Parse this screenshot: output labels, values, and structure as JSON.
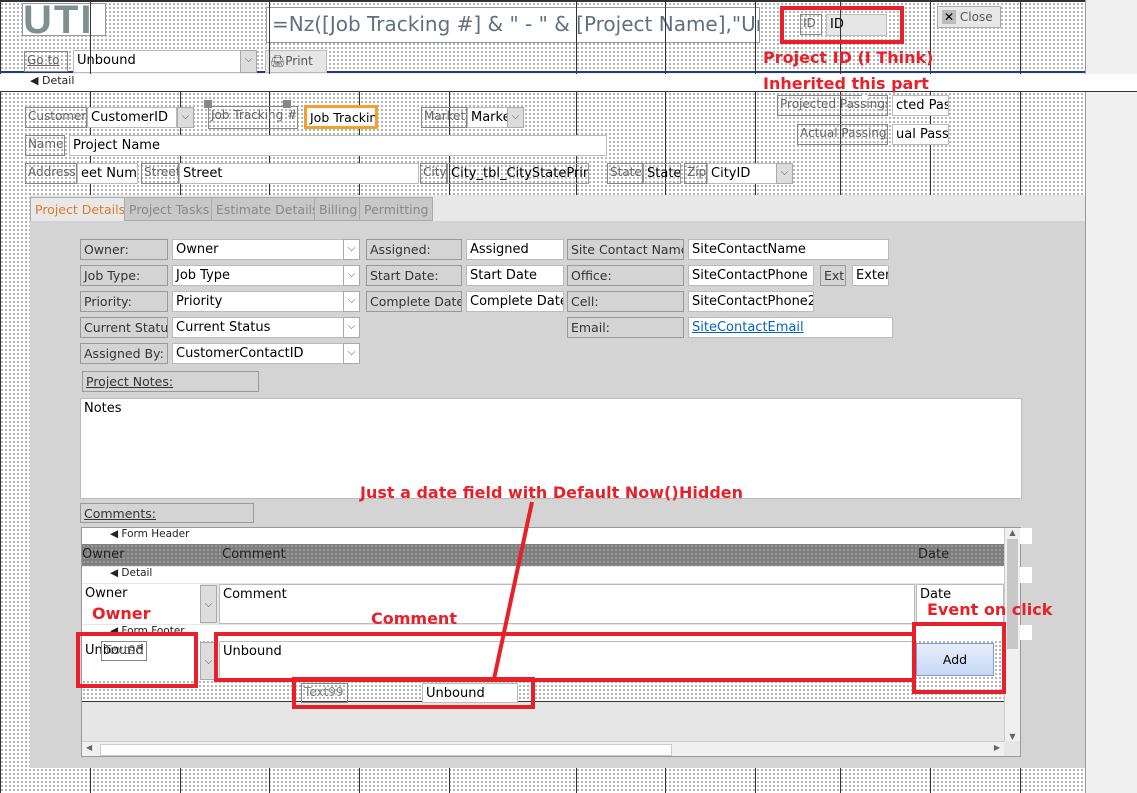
{
  "header": {
    "logo": "UTI",
    "title_expression": "=Nz([Job Tracking #] & \" - \" & [Project Name],\"Untitl",
    "id_label": "ID",
    "id_value": "ID",
    "close_label": "Close",
    "goto_label": "Go to",
    "goto_value": "Unbound",
    "print_label": "Print"
  },
  "sections": {
    "detail": "Detail",
    "form_header": "Form Header",
    "sub_detail": "Detail",
    "form_footer": "Form Footer"
  },
  "detail": {
    "customer_label": "Customer:",
    "customer_value": "CustomerID",
    "job_tracking_label": "Job Tracking #:",
    "job_tracking_value": "Job Tracking #",
    "market_label": "Market:",
    "market_value": "Marke",
    "name_label": "Name:",
    "name_value": "Project Name",
    "address_label": "Address:",
    "address_value": "eet Num",
    "street_label": "Street:",
    "street_value": "Street",
    "city_label": "City:",
    "city_value": "City_tbl_CityStatePrin",
    "state_label": "State:",
    "state_value": "State",
    "zip_label": "Zip:",
    "zip_value": "CityID",
    "projected_label": "Projected Passings:",
    "projected_value": "cted Pas",
    "actual_label": "Actual Passings:",
    "actual_value": "ual Passi"
  },
  "tabs": [
    "Project Details",
    "Project Tasks",
    "Estimate Details",
    "Billing",
    "Permitting"
  ],
  "project": {
    "owner_label": "Owner:",
    "owner_value": "Owner",
    "jobtype_label": "Job Type:",
    "jobtype_value": "Job Type",
    "priority_label": "Priority:",
    "priority_value": "Priority",
    "status_label": "Current Status:",
    "status_value": "Current Status",
    "assignedby_label": "Assigned By:",
    "assignedby_value": "CustomerContactID",
    "assigned_label": "Assigned:",
    "assigned_value": "Assigned",
    "start_label": "Start Date:",
    "start_value": "Start Date",
    "complete_label": "Complete Date:",
    "complete_value": "Complete Date",
    "site_label": "Site Contact Name:",
    "site_value": "SiteContactName",
    "office_label": "Office:",
    "office_value": "SiteContactPhone",
    "ext_label": "Ext.",
    "ext_value": "Exter",
    "cell_label": "Cell:",
    "cell_value": "SiteContactPhone2",
    "email_label": "Email:",
    "email_value": "SiteContactEmail",
    "notes_label": "Project Notes:",
    "notes_value": "Notes",
    "comments_label": "Comments:"
  },
  "subform": {
    "col_owner": "Owner",
    "col_comment": "Comment",
    "col_date": "Date",
    "row_owner": "Owner",
    "row_comment": "Comment",
    "row_date": "Date",
    "footer_owner": "Unbound",
    "footer_text95": "Text95",
    "footer_comment": "Unbound",
    "add_label": "Add",
    "text99_label": "Text99",
    "text99_value": "Unbound"
  },
  "annotations": {
    "project_id": "Project ID (I Think)",
    "inherited": "Inherited this part",
    "date_field": "Just a date field with Default Now()",
    "hidden": "Hidden",
    "owner": "Owner",
    "comment": "Comment",
    "event": "Event on click"
  },
  "colors": {
    "annotation": "#e8202a",
    "selected": "#f4a030"
  }
}
